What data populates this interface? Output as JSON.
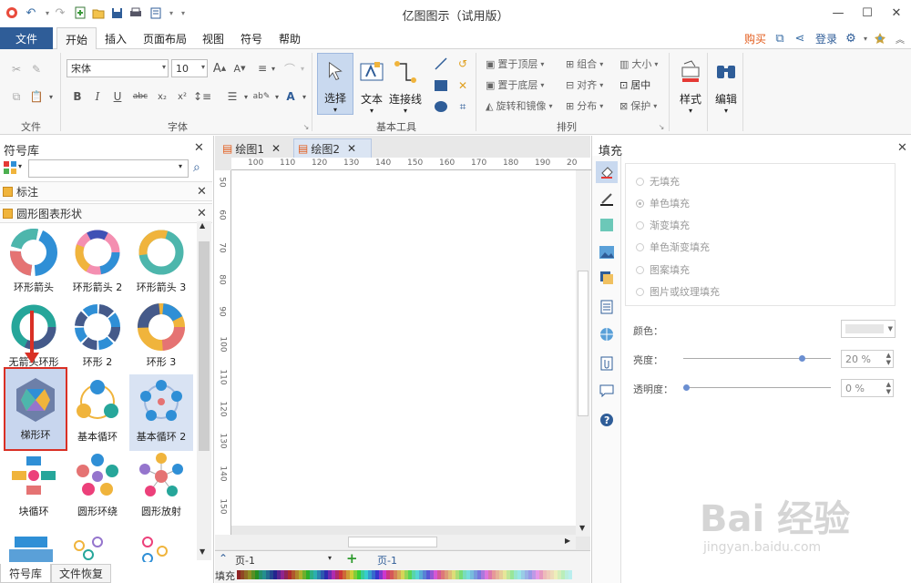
{
  "app": {
    "title": "亿图图示（试用版）"
  },
  "quick_access": [
    "logo-icon",
    "undo-icon",
    "redo-icon",
    "new-icon",
    "open-icon",
    "save-icon",
    "print-icon",
    "export-icon",
    "more-icon"
  ],
  "menu": {
    "file": "文件",
    "tabs": [
      "开始",
      "插入",
      "页面布局",
      "视图",
      "符号",
      "帮助"
    ],
    "active_tab": "开始",
    "buy": "购买",
    "login": "登录"
  },
  "ribbon": {
    "groups": {
      "file": "文件",
      "font": "字体",
      "basic_tools": "基本工具",
      "arrange": "排列"
    },
    "font_name": "宋体",
    "font_size": "10",
    "big_buttons": {
      "select": "选择",
      "text": "文本",
      "connector": "连接线",
      "style": "样式",
      "edit": "编辑"
    },
    "arrange": {
      "bring_front": "置于顶层",
      "group": "组合",
      "size": "大小",
      "send_back": "置于底层",
      "align": "对齐",
      "center": "居中",
      "rotate": "旋转和镜像",
      "distribute": "分布",
      "protect": "保护"
    },
    "format_buttons": [
      "B",
      "I",
      "U",
      "abc",
      "x₂",
      "x²"
    ]
  },
  "symbol_library": {
    "title": "符号库",
    "search_placeholder": "",
    "categories": [
      "标注",
      "圆形图表形状"
    ],
    "shapes": [
      {
        "label": "环形箭头"
      },
      {
        "label": "环形箭头 2"
      },
      {
        "label": "环形箭头 3"
      },
      {
        "label": "无箭头环形"
      },
      {
        "label": "环形 2"
      },
      {
        "label": "环形 3"
      },
      {
        "label": "梯形环"
      },
      {
        "label": "基本循环"
      },
      {
        "label": "基本循环 2"
      },
      {
        "label": "块循环"
      },
      {
        "label": "圆形环绕"
      },
      {
        "label": "圆形放射"
      }
    ],
    "bottom_tabs": [
      "符号库",
      "文件恢复"
    ]
  },
  "document": {
    "tabs": [
      "绘图1",
      "绘图2"
    ],
    "active_tab": "绘图2",
    "ruler_h": [
      "100",
      "110",
      "120",
      "130",
      "140",
      "150",
      "160",
      "170",
      "180",
      "190",
      "20"
    ],
    "ruler_v": [
      "50",
      "60",
      "70",
      "80",
      "90",
      "100",
      "110",
      "120",
      "130",
      "140",
      "150"
    ],
    "page_select": "页-1",
    "page_tab": "页-1",
    "fill_label": "填充"
  },
  "fill_panel": {
    "title": "填充",
    "options": [
      "无填充",
      "单色填充",
      "渐变填充",
      "单色渐变填充",
      "图案填充",
      "图片或纹理填充"
    ],
    "selected_option": "单色填充",
    "color_label": "颜色：",
    "brightness_label": "亮度：",
    "brightness_value": "20 %",
    "brightness_level": 0.8,
    "transparency_label": "透明度：",
    "transparency_value": "0 %",
    "transparency_level": 0.0
  },
  "watermark": {
    "brand": "Bai 经验",
    "url": "jingyan.baidu.com"
  }
}
